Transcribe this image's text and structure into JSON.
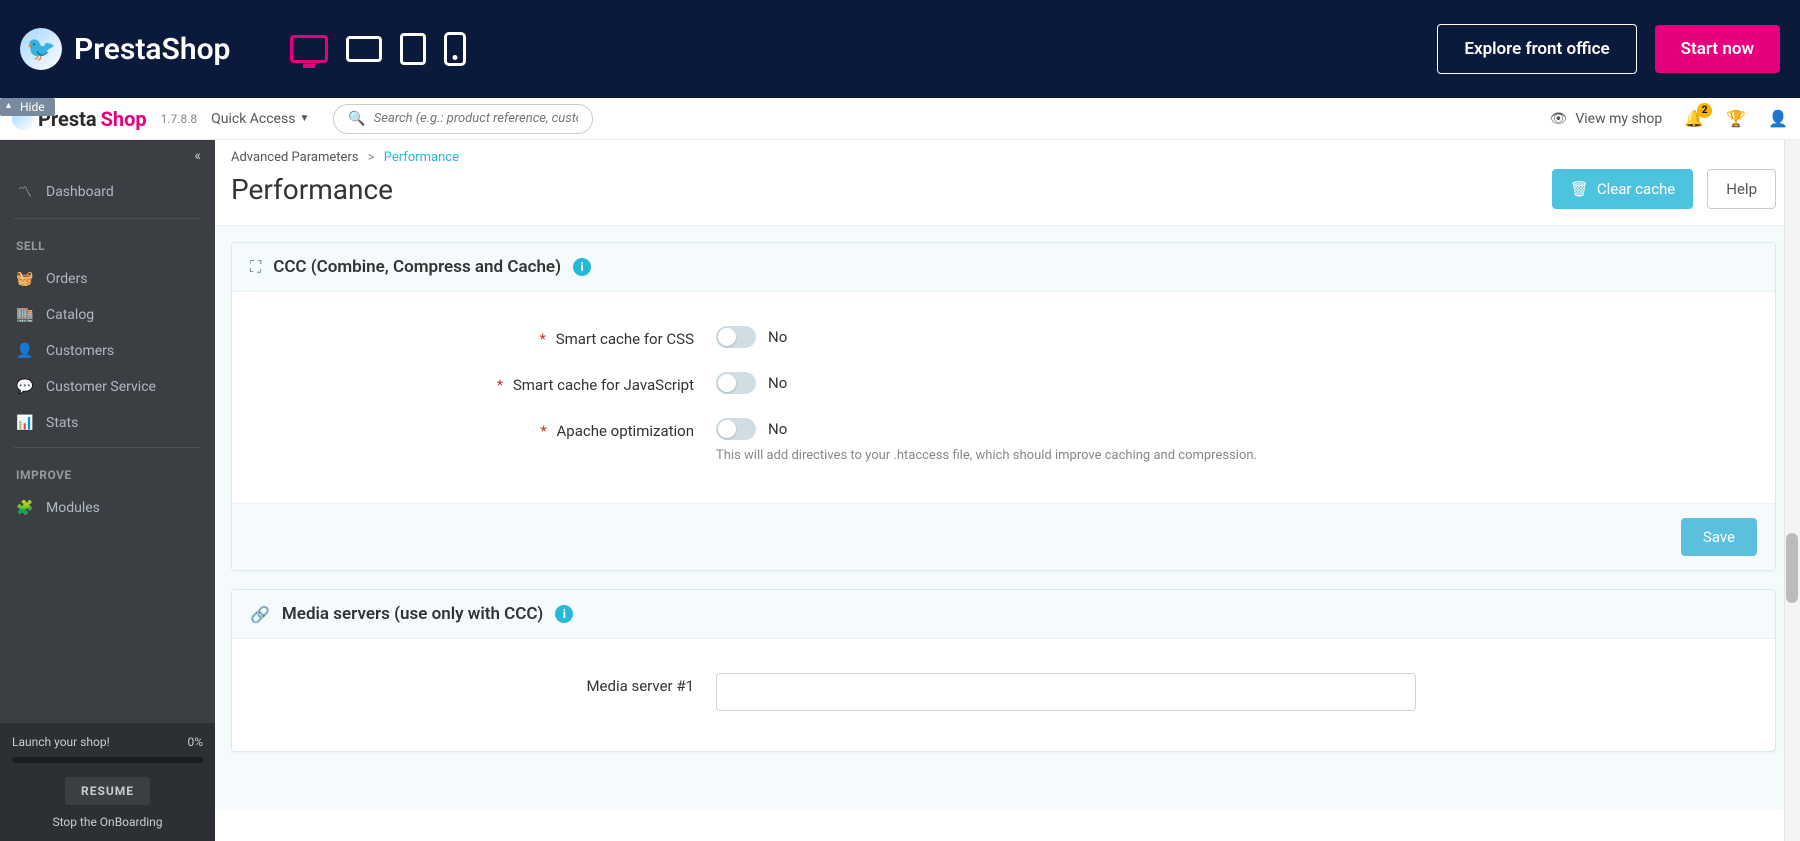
{
  "topbar": {
    "brand": "PrestaShop",
    "explore_btn": "Explore front office",
    "start_btn": "Start now"
  },
  "admin": {
    "brand_a": "Presta",
    "brand_b": "Shop",
    "version": "1.7.8.8",
    "quick_access": "Quick Access",
    "hide": "Hide",
    "search_placeholder": "Search (e.g.: product reference, custom",
    "view_shop": "View my shop",
    "notif_count": "2"
  },
  "breadcrumb": {
    "parent": "Advanced Parameters",
    "current": "Performance"
  },
  "page": {
    "title": "Performance",
    "clear_cache": "Clear cache",
    "help": "Help"
  },
  "sidebar": {
    "dashboard": "Dashboard",
    "sell": "SELL",
    "orders": "Orders",
    "catalog": "Catalog",
    "customers": "Customers",
    "customer_service": "Customer Service",
    "stats": "Stats",
    "improve": "IMPROVE",
    "modules": "Modules",
    "launch": "Launch your shop!",
    "launch_pct": "0%",
    "resume": "RESUME",
    "stop_onboarding": "Stop the OnBoarding"
  },
  "ccc": {
    "title": "CCC (Combine, Compress and Cache)",
    "smart_css": "Smart cache for CSS",
    "smart_css_val": "No",
    "smart_js": "Smart cache for JavaScript",
    "smart_js_val": "No",
    "apache": "Apache optimization",
    "apache_val": "No",
    "apache_help": "This will add directives to your .htaccess file, which should improve caching and compression.",
    "save": "Save"
  },
  "media": {
    "title": "Media servers (use only with CCC)",
    "server1_label": "Media server #1"
  }
}
